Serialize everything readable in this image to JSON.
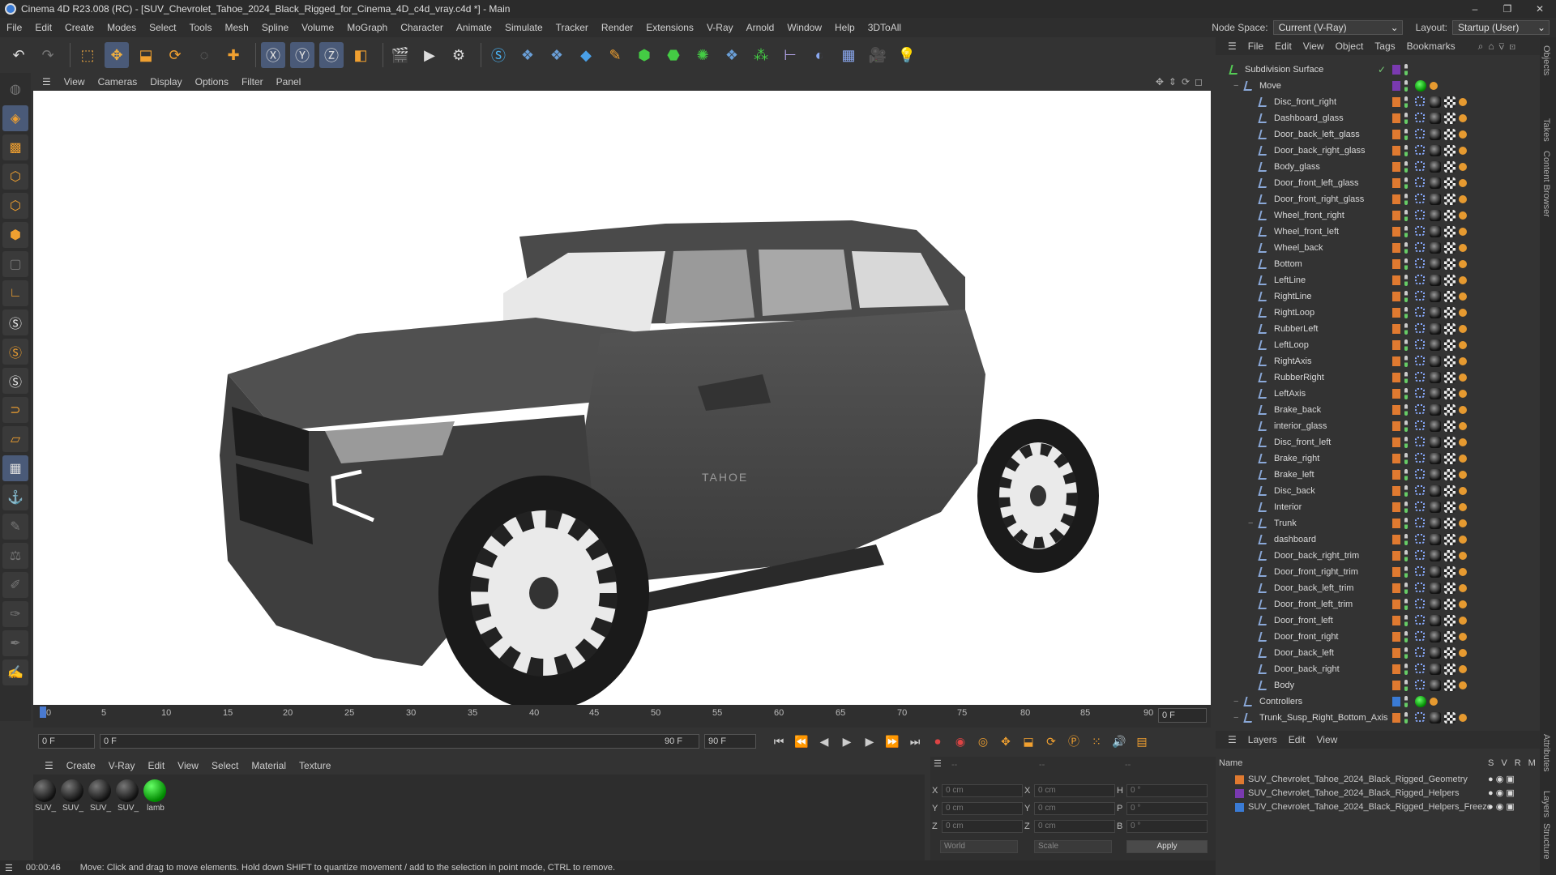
{
  "app": {
    "title": "Cinema 4D R23.008 (RC) - [SUV_Chevrolet_Tahoe_2024_Black_Rigged_for_Cinema_4D_c4d_vray.c4d *] - Main"
  },
  "window_controls": [
    "–",
    "❐",
    "✕"
  ],
  "menu": [
    "File",
    "Edit",
    "Create",
    "Modes",
    "Select",
    "Tools",
    "Mesh",
    "Spline",
    "Volume",
    "MoGraph",
    "Character",
    "Animate",
    "Simulate",
    "Tracker",
    "Render",
    "Extensions",
    "V-Ray",
    "Arnold",
    "Window",
    "Help",
    "3DToAll"
  ],
  "nodespace": {
    "label": "Node Space:",
    "value": "Current (V-Ray)"
  },
  "layout": {
    "label": "Layout:",
    "value": "Startup (User)"
  },
  "viewport_menu": [
    "View",
    "Cameras",
    "Display",
    "Options",
    "Filter",
    "Panel"
  ],
  "car_badge": "TAHOE",
  "timeline": {
    "ticks": [
      "0",
      "5",
      "10",
      "15",
      "20",
      "25",
      "30",
      "35",
      "40",
      "45",
      "50",
      "55",
      "60",
      "65",
      "70",
      "75",
      "80",
      "85",
      "90"
    ],
    "frame_field": "0 F"
  },
  "transport": {
    "start": "0 F",
    "range_start": "0 F",
    "range_end": "90 F",
    "end": "90 F"
  },
  "material_menu": [
    "Create",
    "V-Ray",
    "Edit",
    "View",
    "Select",
    "Material",
    "Texture"
  ],
  "materials": [
    {
      "label": "SUV_",
      "color": "dark"
    },
    {
      "label": "SUV_",
      "color": "dark"
    },
    {
      "label": "SUV_",
      "color": "dark"
    },
    {
      "label": "SUV_",
      "color": "dark"
    },
    {
      "label": "lamb",
      "color": "#22aa22"
    }
  ],
  "coords": {
    "header": [
      "--",
      "--",
      "--"
    ],
    "x": "0 cm",
    "y": "0 cm",
    "z": "0 cm",
    "x2": "0 cm",
    "y2": "0 cm",
    "z2": "0 cm",
    "h": "0 °",
    "p": "0 °",
    "b": "0 °",
    "mode1": "World",
    "mode2": "Scale",
    "apply": "Apply"
  },
  "status": {
    "time": "00:00:46",
    "message": "Move: Click and drag to move elements. Hold down SHIFT to quantize movement / add to the selection in point mode, CTRL to remove."
  },
  "objects_menu": [
    "File",
    "Edit",
    "View",
    "Object",
    "Tags",
    "Bookmarks"
  ],
  "objects": [
    {
      "name": "Subdivision Surface",
      "indent": 0
    },
    {
      "name": "Move",
      "indent": 1
    },
    {
      "name": "Disc_front_right",
      "indent": 2
    },
    {
      "name": "Dashboard_glass",
      "indent": 2
    },
    {
      "name": "Door_back_left_glass",
      "indent": 2
    },
    {
      "name": "Door_back_right_glass",
      "indent": 2
    },
    {
      "name": "Body_glass",
      "indent": 2
    },
    {
      "name": "Door_front_left_glass",
      "indent": 2
    },
    {
      "name": "Door_front_right_glass",
      "indent": 2
    },
    {
      "name": "Wheel_front_right",
      "indent": 2
    },
    {
      "name": "Wheel_front_left",
      "indent": 2
    },
    {
      "name": "Wheel_back",
      "indent": 2
    },
    {
      "name": "Bottom",
      "indent": 2
    },
    {
      "name": "LeftLine",
      "indent": 2
    },
    {
      "name": "RightLine",
      "indent": 2
    },
    {
      "name": "RightLoop",
      "indent": 2
    },
    {
      "name": "RubberLeft",
      "indent": 2
    },
    {
      "name": "LeftLoop",
      "indent": 2
    },
    {
      "name": "RightAxis",
      "indent": 2
    },
    {
      "name": "RubberRight",
      "indent": 2
    },
    {
      "name": "LeftAxis",
      "indent": 2
    },
    {
      "name": "Brake_back",
      "indent": 2
    },
    {
      "name": "interior_glass",
      "indent": 2
    },
    {
      "name": "Disc_front_left",
      "indent": 2
    },
    {
      "name": "Brake_right",
      "indent": 2
    },
    {
      "name": "Brake_left",
      "indent": 2
    },
    {
      "name": "Disc_back",
      "indent": 2
    },
    {
      "name": "Interior",
      "indent": 2
    },
    {
      "name": "Trunk",
      "indent": 2
    },
    {
      "name": "dashboard",
      "indent": 2
    },
    {
      "name": "Door_back_right_trim",
      "indent": 2
    },
    {
      "name": "Door_front_right_trim",
      "indent": 2
    },
    {
      "name": "Door_back_left_trim",
      "indent": 2
    },
    {
      "name": "Door_front_left_trim",
      "indent": 2
    },
    {
      "name": "Door_front_left",
      "indent": 2
    },
    {
      "name": "Door_front_right",
      "indent": 2
    },
    {
      "name": "Door_back_left",
      "indent": 2
    },
    {
      "name": "Door_back_right",
      "indent": 2
    },
    {
      "name": "Body",
      "indent": 2
    },
    {
      "name": "Controllers",
      "indent": 1
    },
    {
      "name": "Trunk_Susp_Right_Bottom_Axis",
      "indent": 1
    }
  ],
  "layers_menu": [
    "Layers",
    "Edit",
    "View"
  ],
  "layers_header": {
    "name": "Name",
    "cols": [
      "S",
      "V",
      "R",
      "M"
    ]
  },
  "layers": [
    {
      "name": "SUV_Chevrolet_Tahoe_2024_Black_Rigged_Geometry",
      "color": "#e07a30"
    },
    {
      "name": "SUV_Chevrolet_Tahoe_2024_Black_Rigged_Helpers",
      "color": "#7a3ab0"
    },
    {
      "name": "SUV_Chevrolet_Tahoe_2024_Black_Rigged_Helpers_Freeze",
      "color": "#3a7bd5"
    }
  ],
  "side_tabs": [
    "Objects",
    "Takes",
    "Content Browser",
    "Attributes",
    "Layers",
    "Structure"
  ]
}
